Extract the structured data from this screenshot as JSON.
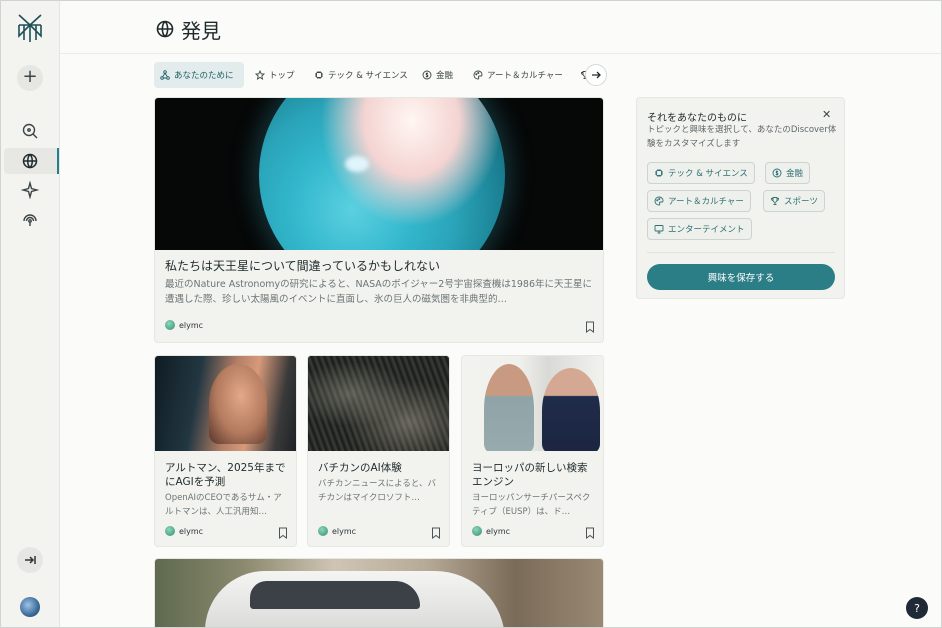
{
  "header": {
    "title": "発見",
    "title_icon": "globe-icon"
  },
  "sidebar": {
    "new_button": "+",
    "items": [
      {
        "name": "search",
        "icon": "search-icon"
      },
      {
        "name": "discover",
        "icon": "globe-icon",
        "active": true
      },
      {
        "name": "spaces",
        "icon": "sparkle-icon"
      },
      {
        "name": "library",
        "icon": "broadcast-icon"
      }
    ]
  },
  "tabs": [
    {
      "label": "あなたのために",
      "icon": "network-icon",
      "active": true
    },
    {
      "label": "トップ",
      "icon": "star-icon"
    },
    {
      "label": "テック & サイエンス",
      "icon": "cpu-icon"
    },
    {
      "label": "金融",
      "icon": "coin-icon"
    },
    {
      "label": "アート＆カルチャー",
      "icon": "palette-icon"
    }
  ],
  "feed": {
    "hero": {
      "title": "私たちは天王星について間違っているかもしれない",
      "description": "最近のNature Astronomyの研究によると、NASAのボイジャー2号宇宙探査機は1986年に天王星に遭遇した際、珍しい太陽風のイベントに直面し、氷の巨人の磁気圏を非典型的…",
      "source": "elymc"
    },
    "small_cards": [
      {
        "title": "アルトマン、2025年までにAGIを予測",
        "description": "OpenAIのCEOであるサム・アルトマンは、人工汎用知…",
        "source": "elymc"
      },
      {
        "title": "バチカンのAI体験",
        "description": "バチカンニュースによると、バチカンはマイクロソフト…",
        "source": "elymc"
      },
      {
        "title": "ヨーロッパの新しい検索エンジン",
        "description": "ヨーロッパンサーチパースペクティブ（EUSP）は、ド…",
        "source": "elymc"
      }
    ]
  },
  "interests_panel": {
    "title": "それをあなたのものに",
    "description": "トピックと興味を選択して、あなたのDiscover体験をカスタマイズします",
    "chips": [
      {
        "label": "テック & サイエンス",
        "icon": "cpu-icon"
      },
      {
        "label": "金融",
        "icon": "coin-icon"
      },
      {
        "label": "アート＆カルチャー",
        "icon": "palette-icon"
      },
      {
        "label": "スポーツ",
        "icon": "trophy-icon"
      },
      {
        "label": "エンターテイメント",
        "icon": "monitor-icon"
      }
    ],
    "save_button": "興味を保存する"
  },
  "help_button": "?",
  "colors": {
    "accent": "#2b7d86",
    "background": "#fbfbf9",
    "card": "#f2f3ef"
  }
}
